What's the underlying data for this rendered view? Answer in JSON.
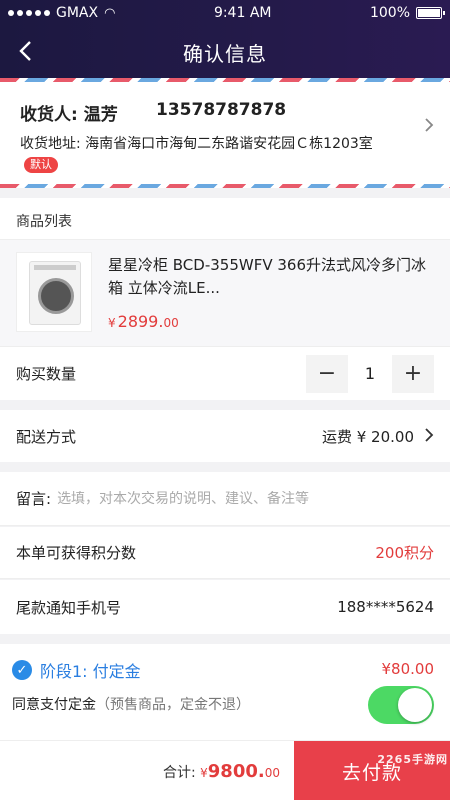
{
  "status_bar": {
    "carrier": "GMAX",
    "time": "9:41 AM",
    "battery": "100%"
  },
  "nav": {
    "title": "确认信息"
  },
  "address": {
    "receiver_label": "收货人:",
    "receiver_name": "温芳",
    "phone": "13578787878",
    "address_label": "收货地址:",
    "address_text": "海南省海口市海甸二东路谐安花园Ｃ栋1203室",
    "default_badge": "默认"
  },
  "products": {
    "section_label": "商品列表",
    "items": [
      {
        "name": "星星冷柜 BCD-355WFV 366升法式风冷多门冰箱 立体冷流LE...",
        "price_symbol": "¥",
        "price_int": "2899.",
        "price_dec": "00"
      }
    ]
  },
  "quantity": {
    "label": "购买数量",
    "value": "1",
    "minus": "−",
    "plus": "+"
  },
  "shipping": {
    "label": "配送方式",
    "value": "运费 ¥ 20.00"
  },
  "note": {
    "label": "留言:",
    "placeholder": "选填，对本次交易的说明、建议、备注等"
  },
  "points": {
    "label": "本单可获得积分数",
    "value": "200积分"
  },
  "notify_phone": {
    "label": "尾款通知手机号",
    "value": "188****5624"
  },
  "deposit": {
    "stage_label": "阶段1: 付定金",
    "stage_amount": "¥80.00",
    "agree_text": "同意支付定金",
    "agree_note": "（预售商品，定金不退）",
    "toggle_on": true
  },
  "footer": {
    "total_label": "合计:",
    "total_symbol": "¥",
    "total_int": "9800.",
    "total_dec": "00",
    "pay_label": "去付款",
    "watermark": "2265手游网"
  },
  "colors": {
    "header_bg": "#221a48",
    "accent_red": "#e23c3c",
    "pay_red": "#e8404a",
    "toggle_green": "#4cd964",
    "stage_blue": "#2a7ee0"
  }
}
